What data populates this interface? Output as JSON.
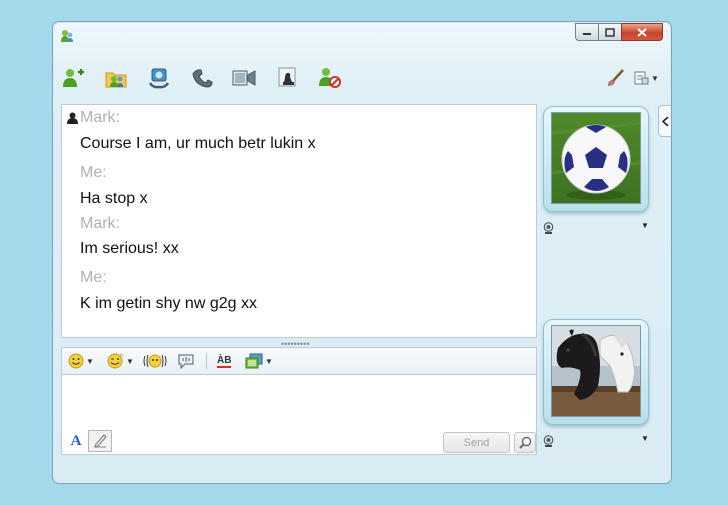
{
  "conversation": {
    "messages": [
      {
        "sender": "Mark:",
        "text": "Course I am, ur much betr lukin x"
      },
      {
        "sender": "Me:",
        "text": "Ha stop x"
      },
      {
        "sender": "Mark:",
        "text": "Im serious! xx"
      },
      {
        "sender": "Me:",
        "text": "K im getin shy nw g2g xx"
      }
    ]
  },
  "compose": {
    "send_label": "Send",
    "font_label": "A",
    "spellcheck_label": "ÀB",
    "splitter": "•••••••••"
  },
  "toolbar": {
    "icons": [
      "invite-contact-icon",
      "share-folder-icon",
      "video-call-icon",
      "call-icon",
      "share-video-icon",
      "games-icon",
      "block-contact-icon"
    ],
    "right_icons": [
      "paintbrush-icon",
      "show-menu-icon"
    ]
  },
  "colors": {
    "background": "#a4d9ec",
    "window": "#dfeff6",
    "close_button": "#c8452e",
    "sender_name": "#b2b2b2"
  }
}
